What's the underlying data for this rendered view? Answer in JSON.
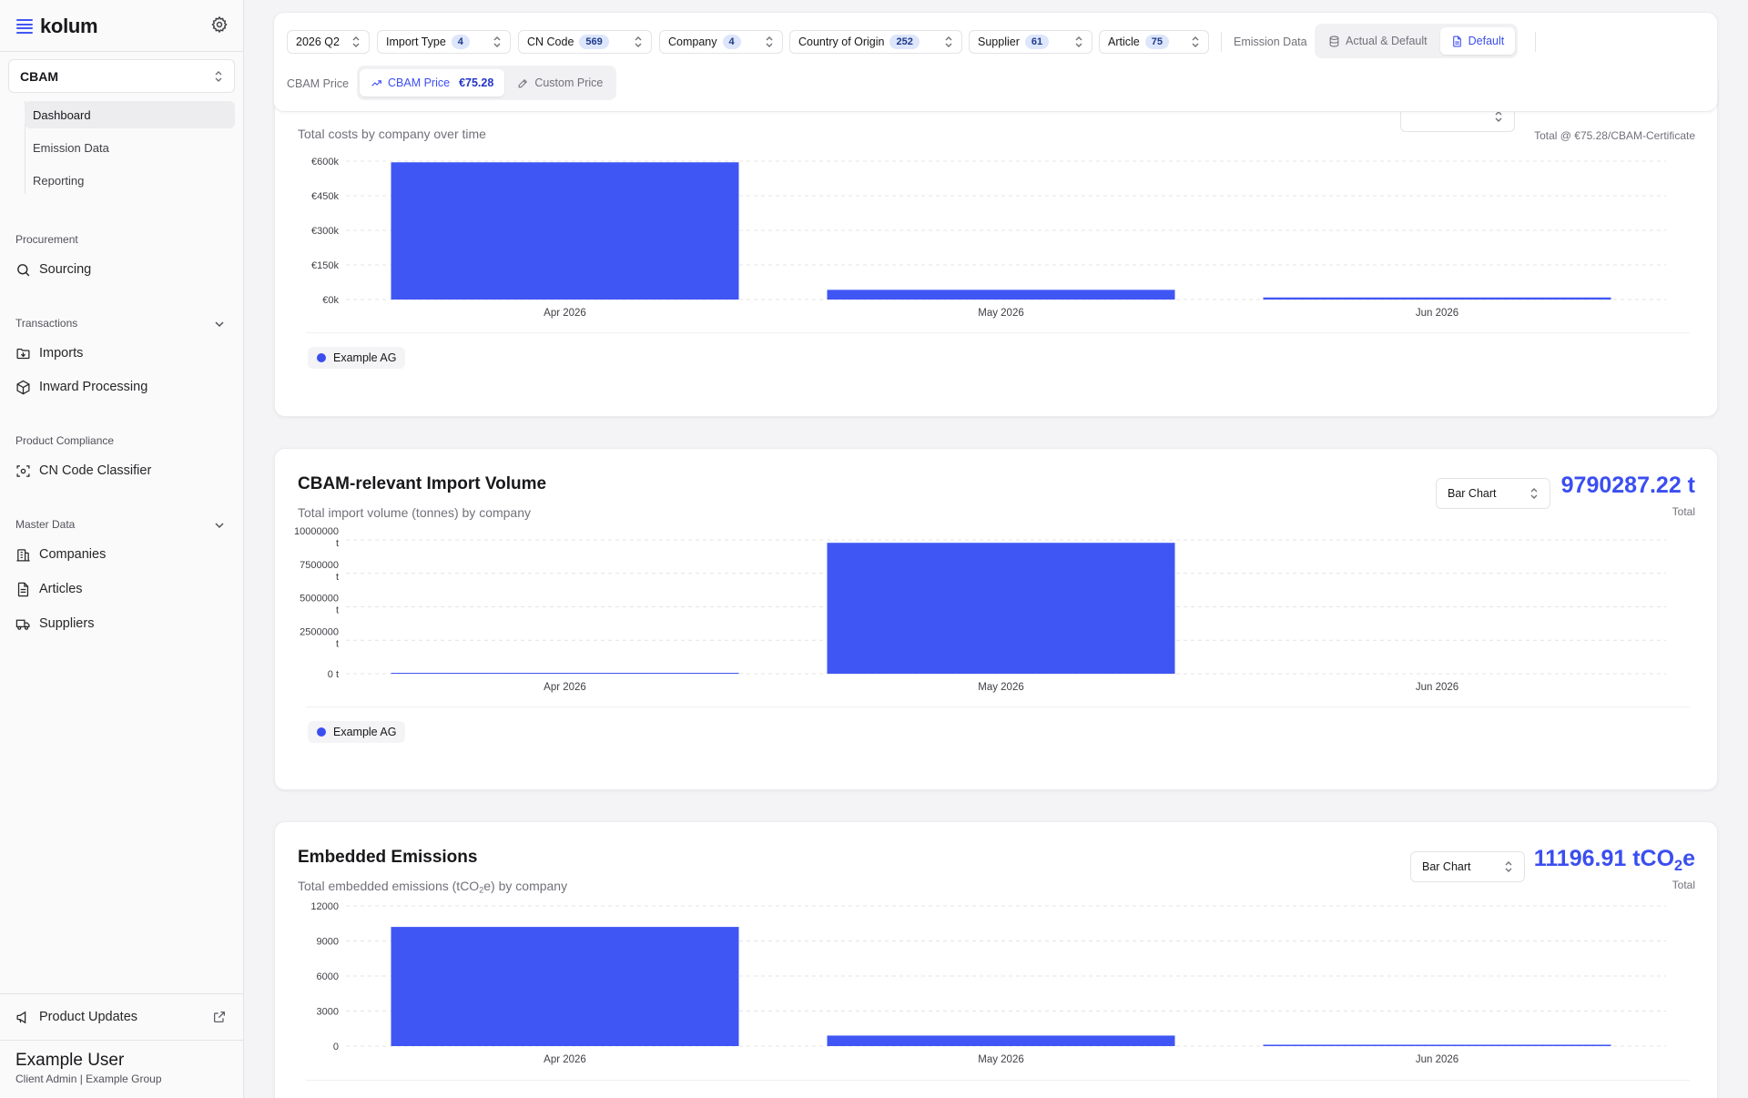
{
  "brand": {
    "name": "kolum"
  },
  "sidebar": {
    "module": "CBAM",
    "sub_items": [
      {
        "label": "Dashboard",
        "active": true
      },
      {
        "label": "Emission Data",
        "active": false
      },
      {
        "label": "Reporting",
        "active": false
      }
    ],
    "sections": {
      "procurement": "Procurement",
      "transactions": "Transactions",
      "product_compliance": "Product Compliance",
      "master_data": "Master Data"
    },
    "items": {
      "sourcing": "Sourcing",
      "imports": "Imports",
      "inward_processing": "Inward Processing",
      "cn_code_classifier": "CN Code Classifier",
      "companies": "Companies",
      "articles": "Articles",
      "suppliers": "Suppliers"
    },
    "product_updates": "Product Updates",
    "user": {
      "name": "Example User",
      "role": "Client Admin | Example Group"
    }
  },
  "filters": {
    "period": "2026 Q2",
    "chips": [
      {
        "label": "Import Type",
        "count": "4"
      },
      {
        "label": "CN Code",
        "count": "569"
      },
      {
        "label": "Company",
        "count": "4"
      },
      {
        "label": "Country of Origin",
        "count": "252"
      },
      {
        "label": "Supplier",
        "count": "61"
      },
      {
        "label": "Article",
        "count": "75"
      }
    ],
    "emission_data_label": "Emission Data",
    "emission_options": [
      "Actual & Default",
      "Default"
    ],
    "cbam_price_label": "CBAM Price",
    "price_option": "CBAM Price",
    "price_value": "€75.28",
    "custom_price": "Custom Price"
  },
  "cards": {
    "costs": {
      "subtitle": "Total costs by company over time",
      "total_label": "Total @ €75.28/CBAM-Certificate",
      "legend": "Example AG"
    },
    "volume": {
      "title": "CBAM-relevant Import Volume",
      "subtitle": "Total import volume (tonnes) by company",
      "chart_type": "Bar Chart",
      "total": "9790287.22 t",
      "total_label": "Total",
      "legend": "Example AG"
    },
    "emissions": {
      "title": "Embedded Emissions",
      "subtitle_pre": "Total embedded emissions (tCO",
      "subtitle_sub": "2",
      "subtitle_post": "e) by company",
      "chart_type": "Bar Chart",
      "total_pre": "11196.91 tCO",
      "total_sub": "2",
      "total_post": "e",
      "total_label": "Total"
    }
  },
  "colors": {
    "accent": "#3b4ef0",
    "bar": "#4056f4"
  },
  "chart_data": [
    {
      "type": "bar",
      "categories": [
        "Apr 2026",
        "May 2026",
        "Jun 2026"
      ],
      "series": [
        {
          "name": "Example AG",
          "values": [
            595000,
            42000,
            9000
          ]
        }
      ],
      "yticks": [
        "€0k",
        "€150k",
        "€300k",
        "€450k",
        "€600k"
      ],
      "ylim": [
        0,
        600000
      ]
    },
    {
      "type": "bar",
      "categories": [
        "Apr 2026",
        "May 2026",
        "Jun 2026"
      ],
      "series": [
        {
          "name": "Example AG",
          "values": [
            8000,
            9782287.22,
            0
          ]
        }
      ],
      "yticks": [
        "0 t",
        "2500000 t",
        "5000000 t",
        "7500000 t",
        "10000000 t"
      ],
      "ylim": [
        0,
        10000000
      ]
    },
    {
      "type": "bar",
      "categories": [
        "Apr 2026",
        "May 2026",
        "Jun 2026"
      ],
      "series": [
        {
          "name": "Example AG",
          "values": [
            10200,
            900,
            120
          ]
        }
      ],
      "yticks": [
        "0",
        "3000",
        "6000",
        "9000",
        "12000"
      ],
      "ylim": [
        0,
        12000
      ]
    }
  ]
}
